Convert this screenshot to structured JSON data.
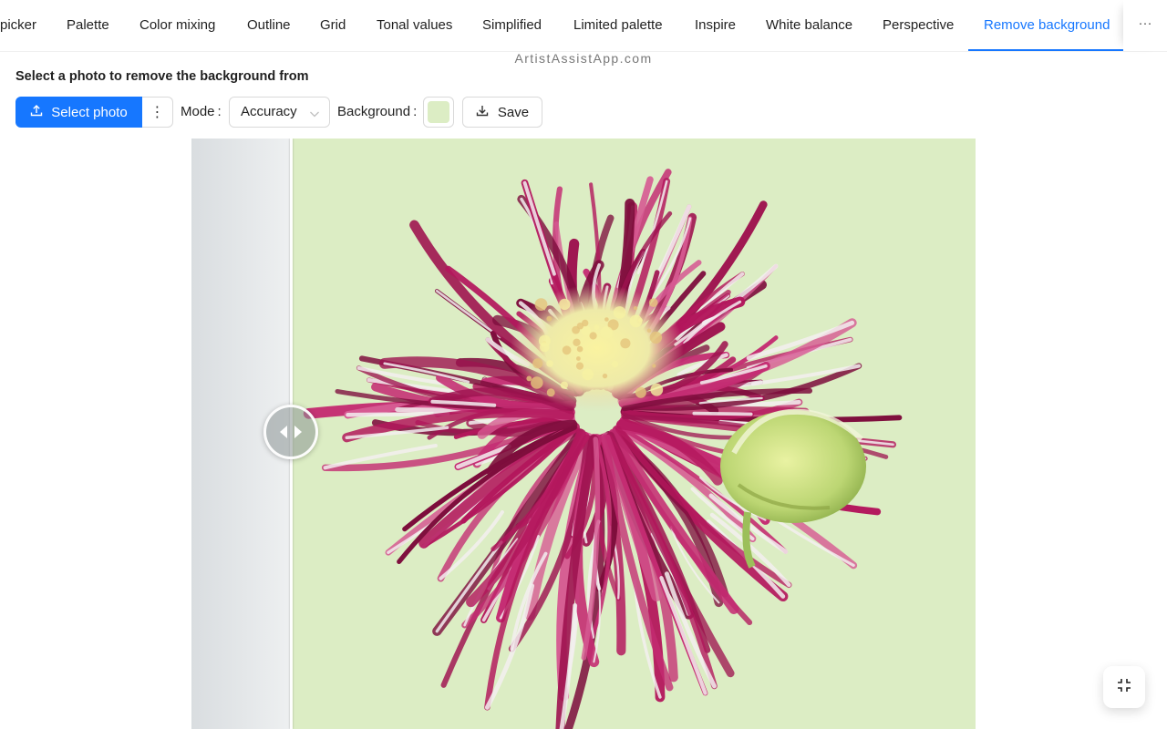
{
  "tabs": [
    {
      "label": "picker"
    },
    {
      "label": "Palette"
    },
    {
      "label": "Color mixing"
    },
    {
      "label": "Outline"
    },
    {
      "label": "Grid"
    },
    {
      "label": "Tonal values"
    },
    {
      "label": "Simplified"
    },
    {
      "label": "Limited palette"
    },
    {
      "label": "Inspire"
    },
    {
      "label": "White balance"
    },
    {
      "label": "Perspective"
    },
    {
      "label": "Remove background",
      "active": true
    }
  ],
  "more_label": "···",
  "watermark": "ArtistAssistApp.com",
  "heading": "Select a photo to remove the background from",
  "toolbar": {
    "select_photo_label": "Select photo",
    "kebab_label": "⋮",
    "mode_label": "Mode",
    "mode_value": "Accuracy",
    "background_label": "Background",
    "background_color": "#dcedc4",
    "save_label": "Save"
  },
  "icons": {
    "upload": "upload-icon",
    "download": "download-icon",
    "chevron": "chevron-down-icon",
    "slider": "compare-slider-icon",
    "collapse": "fullscreen-exit-icon"
  },
  "colors": {
    "accent": "#1677ff",
    "petal": "#b3175c",
    "petal_dark": "#7d0d3c",
    "center": "#f2f0a6",
    "bud": "#bcd673"
  }
}
